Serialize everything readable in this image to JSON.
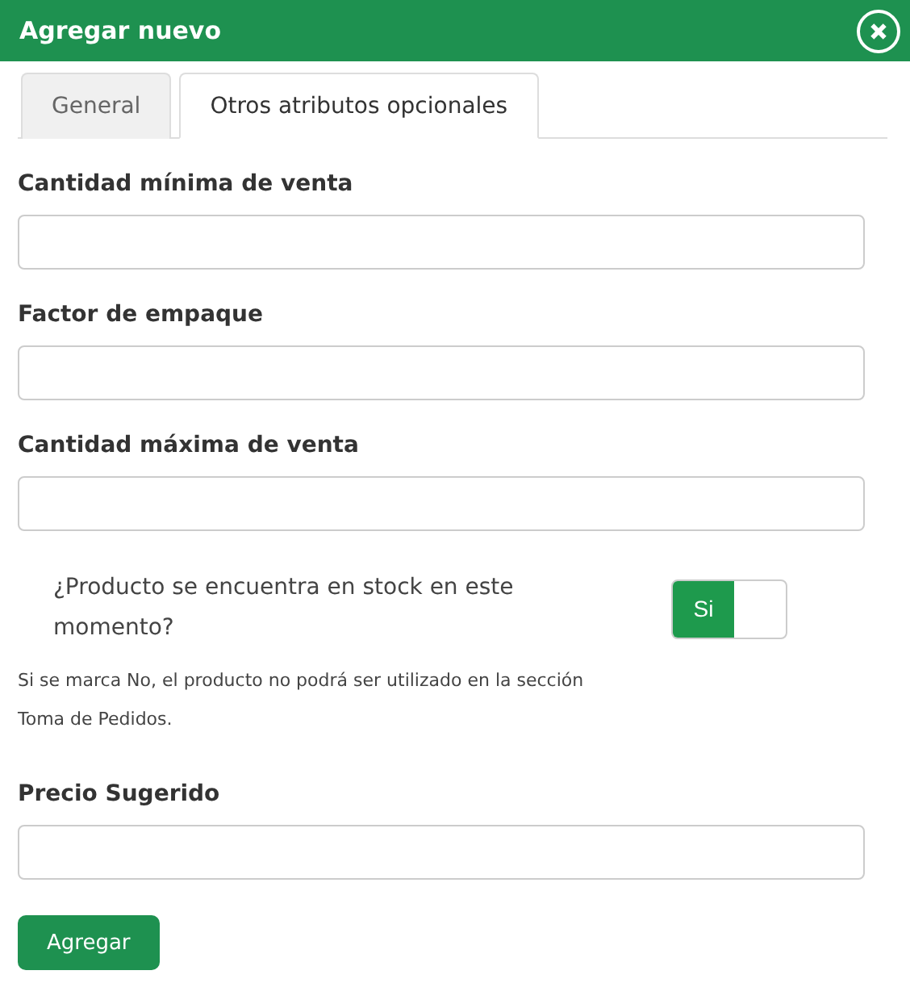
{
  "window": {
    "title": "Agregar nuevo"
  },
  "tabs": [
    {
      "label": "General",
      "selected": false
    },
    {
      "label": "Otros atributos opcionales",
      "selected": true
    }
  ],
  "fields_top": [
    {
      "label": "Cantidad mínima de venta"
    },
    {
      "label": "Factor de empaque"
    },
    {
      "label": "Cantidad máxima de venta"
    }
  ],
  "stock": {
    "question": "¿Producto se encuentra en stock en este momento?",
    "toggle": {
      "label": "Si",
      "on": true
    },
    "help": "Si se marca No, el producto no podrá ser utilizado en la sección Toma de Pedidos."
  },
  "fields_bottom": [
    {
      "label": "Precio Sugerido"
    }
  ],
  "submit": "Agregar"
}
